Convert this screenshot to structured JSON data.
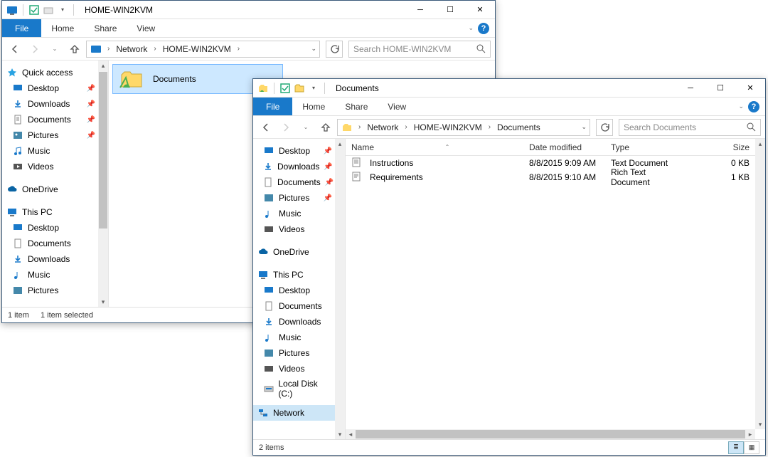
{
  "w1": {
    "title": "HOME-WIN2KVM",
    "tabs": {
      "file": "File",
      "home": "Home",
      "share": "Share",
      "view": "View"
    },
    "breadcrumb": {
      "root": "Network",
      "seg1": "HOME-WIN2KVM"
    },
    "search_placeholder": "Search HOME-WIN2KVM",
    "nav": {
      "quick": "Quick access",
      "desktop": "Desktop",
      "downloads": "Downloads",
      "documents": "Documents",
      "pictures": "Pictures",
      "music": "Music",
      "videos": "Videos",
      "onedrive": "OneDrive",
      "thispc": "This PC",
      "pc_desktop": "Desktop",
      "pc_documents": "Documents",
      "pc_downloads": "Downloads",
      "pc_music": "Music",
      "pc_pictures": "Pictures"
    },
    "folder_label": "Documents",
    "status_left": "1 item",
    "status_sel": "1 item selected"
  },
  "w2": {
    "title": "Documents",
    "tabs": {
      "file": "File",
      "home": "Home",
      "share": "Share",
      "view": "View"
    },
    "breadcrumb": {
      "root": "Network",
      "seg1": "HOME-WIN2KVM",
      "seg2": "Documents"
    },
    "search_placeholder": "Search Documents",
    "nav": {
      "desktop": "Desktop",
      "downloads": "Downloads",
      "documents": "Documents",
      "pictures": "Pictures",
      "music": "Music",
      "videos": "Videos",
      "onedrive": "OneDrive",
      "thispc": "This PC",
      "pc_desktop": "Desktop",
      "pc_documents": "Documents",
      "pc_downloads": "Downloads",
      "pc_music": "Music",
      "pc_pictures": "Pictures",
      "pc_videos": "Videos",
      "localdisk": "Local Disk (C:)",
      "network": "Network"
    },
    "cols": {
      "name": "Name",
      "date": "Date modified",
      "type": "Type",
      "size": "Size"
    },
    "files": [
      {
        "name": "Instructions",
        "date": "8/8/2015 9:09 AM",
        "ftype": "Text Document",
        "size": "0 KB"
      },
      {
        "name": "Requirements",
        "date": "8/8/2015 9:10 AM",
        "ftype": "Rich Text Document",
        "size": "1 KB"
      }
    ],
    "status_left": "2 items"
  }
}
